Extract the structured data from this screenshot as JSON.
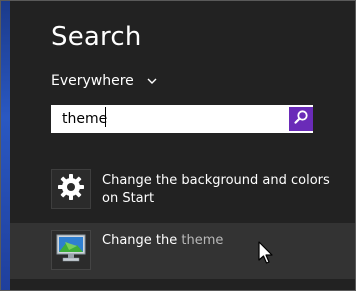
{
  "search_panel": {
    "title": "Search",
    "scope": {
      "label": "Everywhere"
    },
    "query": "theme"
  },
  "results": [
    {
      "label": "Change the background and colors on Start",
      "icon": "gear-icon"
    },
    {
      "label_prefix": "Change the ",
      "label_highlight": "theme",
      "icon": "display-settings-icon"
    }
  ],
  "colors": {
    "search_button": "#6a2bb8",
    "selected_result_bg": "#333333",
    "panel_bg": "#222222"
  }
}
